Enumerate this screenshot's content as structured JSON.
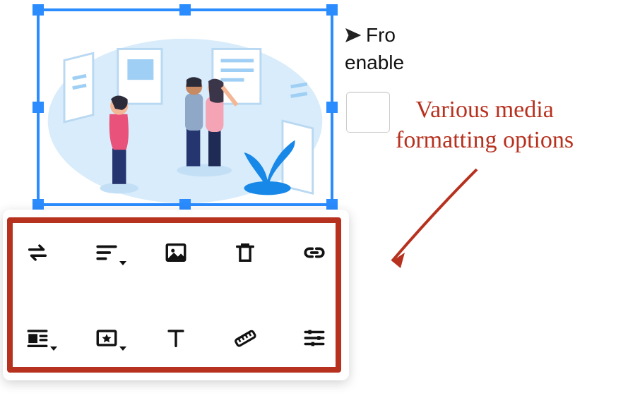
{
  "background_text": {
    "line1_icon": "paper-plane-icon",
    "line1": "Fro",
    "line2": "enable"
  },
  "annotation": {
    "text": "Various media\nformatting options"
  },
  "toolbar": {
    "row1": [
      {
        "name": "replace-button",
        "icon": "swap-icon",
        "has_caret": false
      },
      {
        "name": "align-button",
        "icon": "align-left-icon",
        "has_caret": true
      },
      {
        "name": "display-mode-button",
        "icon": "image-icon",
        "has_caret": false
      },
      {
        "name": "delete-button",
        "icon": "trash-icon",
        "has_caret": false
      },
      {
        "name": "link-button",
        "icon": "link-icon",
        "has_caret": false
      }
    ],
    "row2": [
      {
        "name": "wrap-text-button",
        "icon": "wrap-icon",
        "has_caret": true
      },
      {
        "name": "alt-text-button",
        "icon": "star-box-icon",
        "has_caret": true
      },
      {
        "name": "caption-button",
        "icon": "caption-t-icon",
        "has_caret": false
      },
      {
        "name": "resize-button",
        "icon": "ruler-icon",
        "has_caret": false
      },
      {
        "name": "advanced-button",
        "icon": "tune-icon",
        "has_caret": false
      }
    ]
  },
  "colors": {
    "selection": "#2B8CFF",
    "highlight": "#B7311F"
  }
}
